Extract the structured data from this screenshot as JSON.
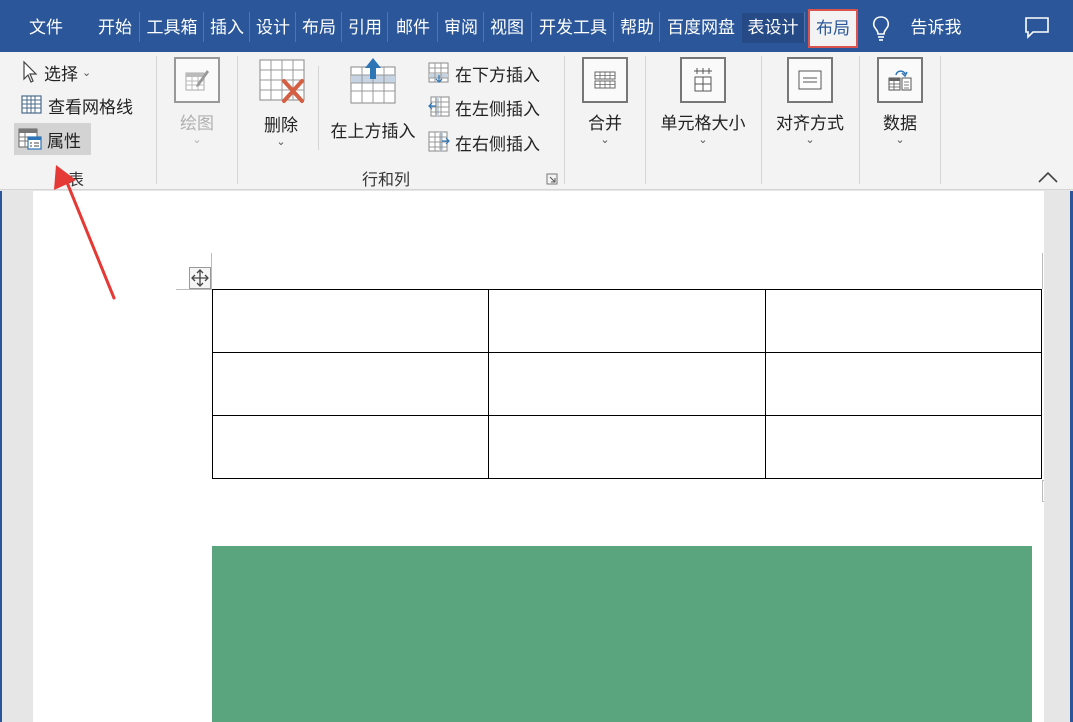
{
  "tabs": {
    "items": [
      {
        "label": "文件"
      },
      {
        "label": "开始"
      },
      {
        "label": "工具箱"
      },
      {
        "label": "插入"
      },
      {
        "label": "设计"
      },
      {
        "label": "布局"
      },
      {
        "label": "引用"
      },
      {
        "label": "邮件"
      },
      {
        "label": "审阅"
      },
      {
        "label": "视图"
      },
      {
        "label": "开发工具"
      },
      {
        "label": "帮助"
      },
      {
        "label": "百度网盘"
      },
      {
        "label": "表设计"
      },
      {
        "label": "布局"
      }
    ],
    "active_index": 14,
    "tell_me": "告诉我",
    "lightbulb_icon": "lightbulb-icon",
    "comment_icon": "comment-icon"
  },
  "ribbon": {
    "table_group": {
      "label": "表",
      "select": "选择",
      "view_gridlines": "查看网格线",
      "properties": "属性"
    },
    "draw_group": {
      "draw": "绘图"
    },
    "rows_cols_group": {
      "label": "行和列",
      "delete": "删除",
      "insert_above": "在上方插入",
      "insert_below": "在下方插入",
      "insert_left": "在左侧插入",
      "insert_right": "在右侧插入"
    },
    "merge": "合并",
    "cell_size": "单元格大小",
    "alignment": "对齐方式",
    "data": "数据",
    "chevron": "⌄"
  },
  "document": {
    "table": {
      "rows": 3,
      "cols": 3,
      "cells": [
        [
          "",
          "",
          ""
        ],
        [
          "",
          "",
          ""
        ],
        [
          "",
          "",
          ""
        ]
      ]
    },
    "green_block_color": "#5aa57d"
  },
  "annotation": {
    "arrow_color": "#e53935",
    "points_to": "属性"
  },
  "colors": {
    "brand_blue": "#2b579a",
    "active_tab_outline": "#d9534f",
    "delete_x": "#d45f43",
    "insert_arrow": "#2e75b6"
  }
}
